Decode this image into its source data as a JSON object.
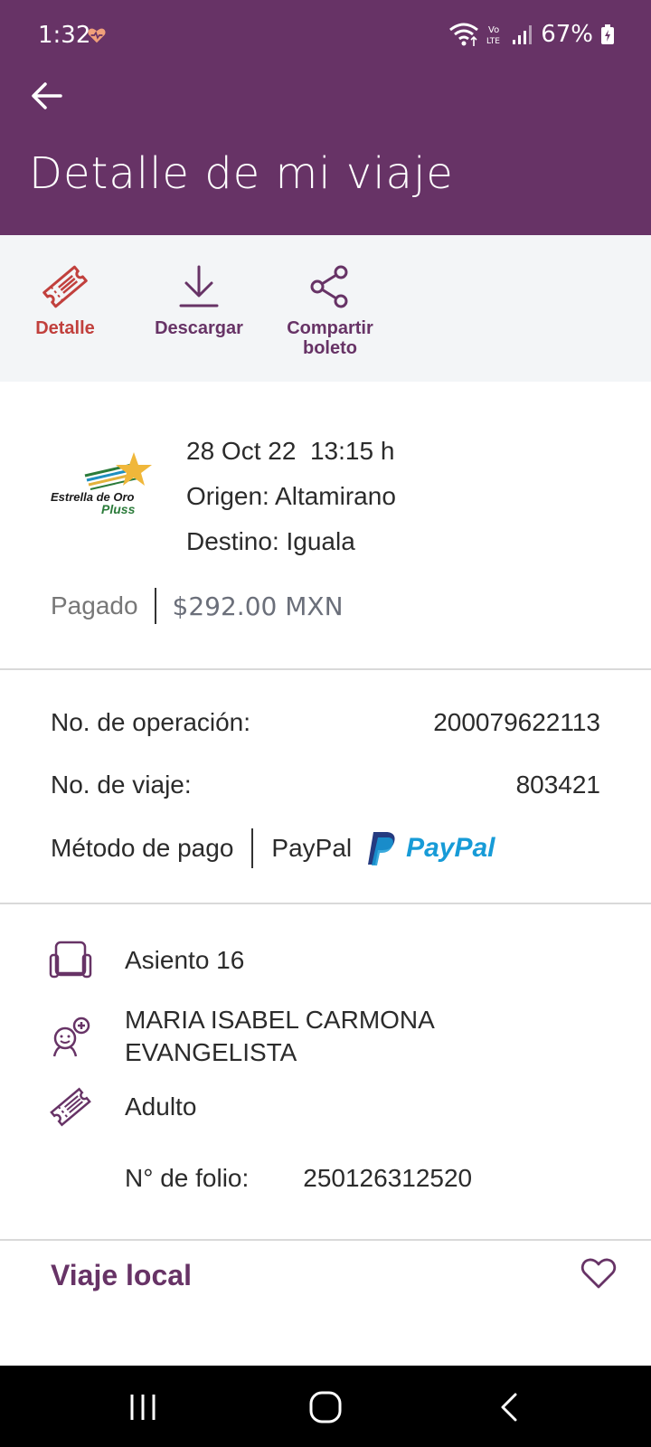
{
  "status": {
    "time": "1:32",
    "battery": "67%",
    "volte": "Vo LTE"
  },
  "header": {
    "title": "Detalle de mi viaje",
    "bg_color": "#673366"
  },
  "actions": {
    "detalle": "Detalle",
    "descargar": "Descargar",
    "compartir_line1": "Compartir",
    "compartir_line2": "boleto"
  },
  "trip": {
    "logo_line1": "Estrella de Oro",
    "logo_line2": "Pluss",
    "date_time": "28 Oct 22  13:15 h",
    "origin": "Origen: Altamirano",
    "destination": "Destino: Iguala",
    "paid_label": "Pagado",
    "amount": "$292.00 MXN"
  },
  "details": {
    "operation_label": "No. de operación:",
    "operation_value": "200079622113",
    "trip_label": "No. de viaje:",
    "trip_value": "803421",
    "payment_label": "Método de pago",
    "payment_value": "PayPal",
    "paypal_logo_text": "PayPal"
  },
  "passenger": {
    "seat": "Asiento 16",
    "name_line1": "MARIA ISABEL CARMONA",
    "name_line2": "EVANGELISTA",
    "type": "Adulto",
    "folio_label": "N° de folio:",
    "folio_value": "250126312520"
  },
  "footer": {
    "trip_type": "Viaje local"
  }
}
